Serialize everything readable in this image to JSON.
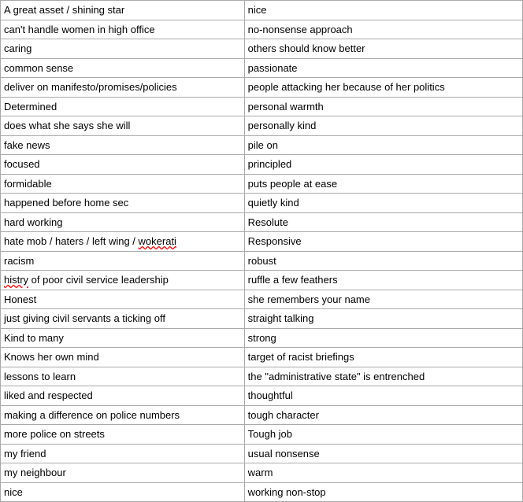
{
  "rows": [
    [
      "A great asset / shining star",
      "nice"
    ],
    [
      "can't handle women in high office",
      "no-nonsense approach"
    ],
    [
      "caring",
      "others should know better"
    ],
    [
      "common sense",
      "passionate"
    ],
    [
      "deliver on manifesto/promises/policies",
      "people attacking her because of her politics"
    ],
    [
      "Determined",
      "personal warmth"
    ],
    [
      "does what she says she will",
      "personally kind"
    ],
    [
      "fake news",
      "pile on"
    ],
    [
      "focused",
      "principled"
    ],
    [
      "formidable",
      "puts people at ease"
    ],
    [
      "happened before home sec",
      "quietly kind"
    ],
    [
      "hard working",
      "Resolute"
    ],
    [
      "hate mob / haters / left wing / wokerati",
      "Responsive"
    ],
    [
      "racism",
      "robust"
    ],
    [
      "histry of poor civil service leadership",
      "ruffle a few feathers"
    ],
    [
      "Honest",
      "she remembers your name"
    ],
    [
      "just giving civil servants a ticking off",
      "straight talking"
    ],
    [
      "Kind to many",
      "strong"
    ],
    [
      "Knows her own mind",
      "target of racist briefings"
    ],
    [
      "lessons to learn",
      "the \"administrative state\" is entrenched"
    ],
    [
      "liked and respected",
      "thoughtful"
    ],
    [
      "making a difference on police numbers",
      "tough character"
    ],
    [
      "more police on streets",
      "Tough job"
    ],
    [
      "my friend",
      "usual nonsense"
    ],
    [
      "my neighbour",
      "warm"
    ],
    [
      "nice",
      "working non-stop"
    ]
  ],
  "special_underline": {
    "wokerati": true,
    "histry": true
  }
}
